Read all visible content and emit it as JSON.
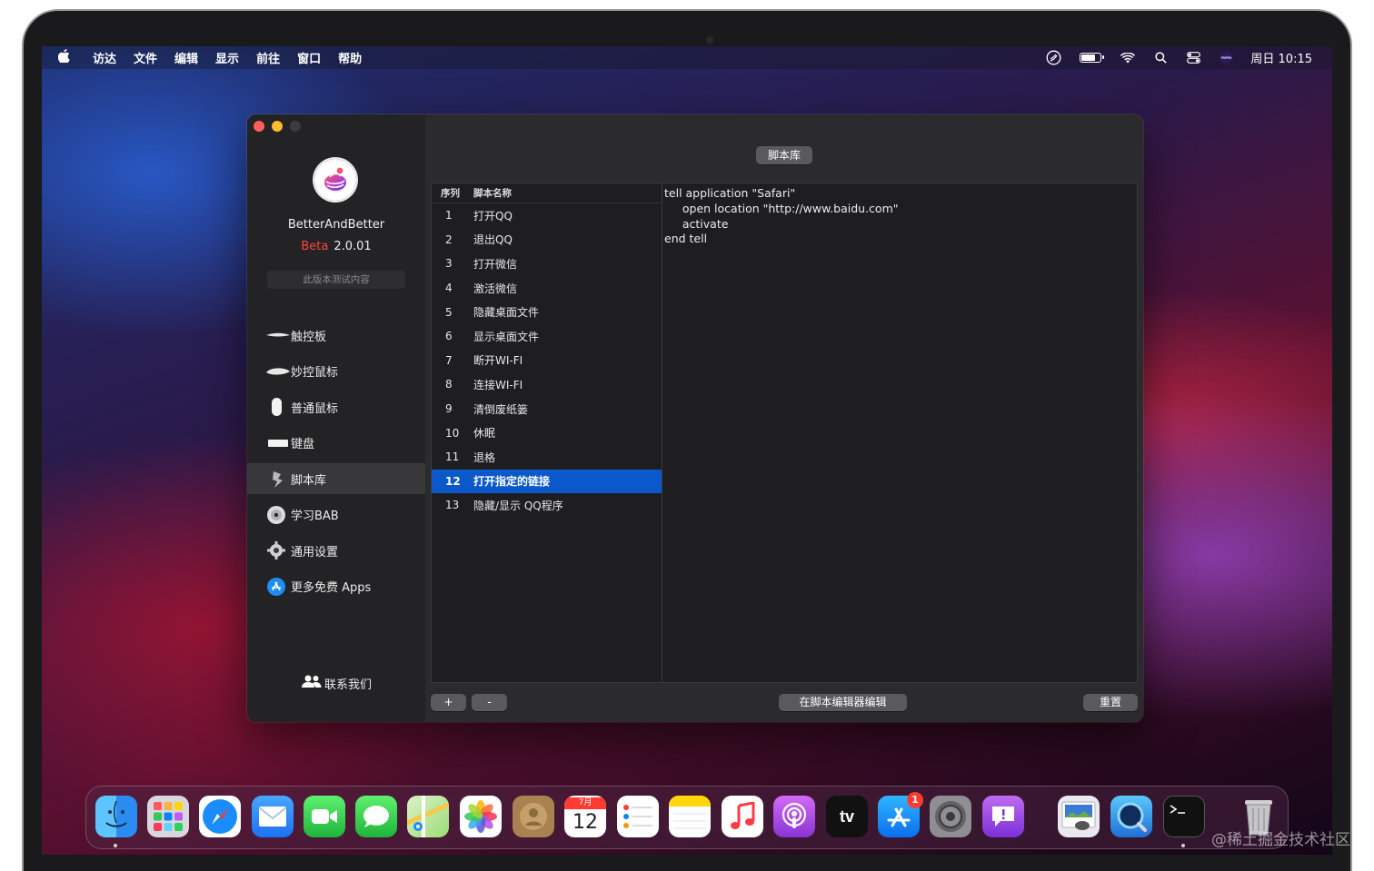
{
  "menubar": {
    "apple": "",
    "items": [
      "访达",
      "文件",
      "编辑",
      "显示",
      "前往",
      "窗口",
      "帮助"
    ],
    "clock": "周日 10:15",
    "battery_level": 0.65
  },
  "window": {
    "app_name": "BetterAndBetter",
    "beta_label": "Beta",
    "version": "2.0.01",
    "test_note": "此版本测试内容",
    "nav": [
      {
        "label": "触控板",
        "icon": "trackpad-icon"
      },
      {
        "label": "妙控鼠标",
        "icon": "magic-mouse-icon"
      },
      {
        "label": "普通鼠标",
        "icon": "mouse-icon"
      },
      {
        "label": "键盘",
        "icon": "keyboard-icon"
      },
      {
        "label": "脚本库",
        "icon": "script-icon"
      },
      {
        "label": "学习BAB",
        "icon": "dvd-icon"
      },
      {
        "label": "通用设置",
        "icon": "gear-icon"
      },
      {
        "label": "更多免费 Apps",
        "icon": "app-store-icon"
      }
    ],
    "active_nav_index": 4,
    "contact_label": "联系我们",
    "segment_label": "脚本库",
    "table": {
      "headers": [
        "序列",
        "脚本名称"
      ],
      "rows": [
        {
          "num": "1",
          "name": "打开QQ"
        },
        {
          "num": "2",
          "name": "退出QQ"
        },
        {
          "num": "3",
          "name": "打开微信"
        },
        {
          "num": "4",
          "name": "激活微信"
        },
        {
          "num": "5",
          "name": "隐藏桌面文件"
        },
        {
          "num": "6",
          "name": "显示桌面文件"
        },
        {
          "num": "7",
          "name": "断开WI-FI"
        },
        {
          "num": "8",
          "name": "连接WI-FI"
        },
        {
          "num": "9",
          "name": "清倒废纸篓"
        },
        {
          "num": "10",
          "name": "休眠"
        },
        {
          "num": "11",
          "name": "退格"
        },
        {
          "num": "12",
          "name": "打开指定的链接"
        },
        {
          "num": "13",
          "name": "隐藏/显示 QQ程序"
        }
      ],
      "selected_index": 11
    },
    "script_text": "tell application \"Safari\"\n     open location \"http://www.baidu.com\"\n     activate\nend tell",
    "buttons": {
      "add": "+",
      "remove": "-",
      "edit_in_editor": "在脚本编辑器编辑",
      "reset": "重置"
    }
  },
  "dock": {
    "apps": [
      {
        "name": "finder-icon",
        "running": true
      },
      {
        "name": "launchpad-icon",
        "running": false
      },
      {
        "name": "safari-icon",
        "running": false
      },
      {
        "name": "mail-icon",
        "running": false
      },
      {
        "name": "facetime-icon",
        "running": false
      },
      {
        "name": "messages-icon",
        "running": false
      },
      {
        "name": "maps-icon",
        "running": false
      },
      {
        "name": "photos-icon",
        "running": false
      },
      {
        "name": "contacts-icon",
        "running": false
      },
      {
        "name": "calendar-icon",
        "running": false,
        "month": "7月",
        "day": "12"
      },
      {
        "name": "reminders-icon",
        "running": false
      },
      {
        "name": "notes-icon",
        "running": false
      },
      {
        "name": "music-icon",
        "running": false
      },
      {
        "name": "podcasts-icon",
        "running": false
      },
      {
        "name": "apple-tv-icon",
        "running": false,
        "text": "tv"
      },
      {
        "name": "app-store-icon",
        "running": false,
        "badge": "1"
      },
      {
        "name": "system-preferences-icon",
        "running": false
      },
      {
        "name": "feedback-assistant-icon",
        "running": false
      },
      {
        "name": "preview-icon",
        "running": false
      },
      {
        "name": "quicktime-icon",
        "running": false
      },
      {
        "name": "terminal-icon",
        "running": true
      },
      {
        "name": "trash-icon",
        "running": false
      }
    ]
  },
  "watermark": "@稀土掘金技术社区"
}
